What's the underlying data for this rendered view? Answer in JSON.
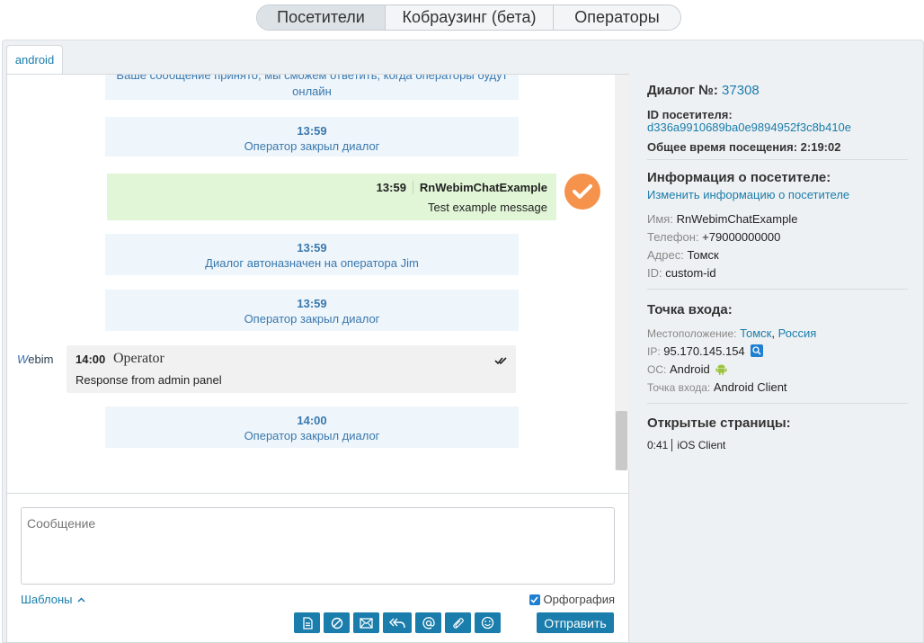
{
  "top_tabs": [
    "Посетители",
    "Кобраузинг (бета)",
    "Операторы"
  ],
  "subtab": "android",
  "messages": {
    "partial_text": "Ваше сообщение принято, мы сможем ответить, когда операторы будут онлайн",
    "sys1": {
      "time": "13:59",
      "text": "Оператор закрыл диалог"
    },
    "visitor": {
      "time": "13:59",
      "name": "RnWebimChatExample",
      "text": "Test example message"
    },
    "sys2": {
      "time": "13:59",
      "text": "Диалог автоназначен на оператора Jim"
    },
    "sys3": {
      "time": "13:59",
      "text": "Оператор закрыл диалог"
    },
    "operator": {
      "logo": "Webim",
      "time": "14:00",
      "name": "Operator",
      "text": "Response from admin panel"
    },
    "sys4": {
      "time": "14:00",
      "text": "Оператор закрыл диалог"
    }
  },
  "composer": {
    "placeholder": "Сообщение",
    "templates_label": "Шаблоны",
    "spellcheck_label": "Орфография",
    "spellcheck_checked": true,
    "toolbar_icons": [
      "document-icon",
      "block-icon",
      "mail-icon",
      "reply-all-icon",
      "at-icon",
      "attach-icon",
      "smile-icon"
    ],
    "send_label": "Отправить"
  },
  "right": {
    "dialog_label": "Диалог №:",
    "dialog_number": "37308",
    "visitor_id_label": "ID посетителя:",
    "visitor_id": "d336a9910689ba0e9894952f3c8b410e",
    "visit_time_label": "Общее время посещения:",
    "visit_time": "2:19:02",
    "info_title": "Информация о посетителе:",
    "edit_info_link": "Изменить информацию о посетителе",
    "name_k": "Имя:",
    "name_v": "RnWebimChatExample",
    "phone_k": "Телефон:",
    "phone_v": "+79000000000",
    "address_k": "Адрес:",
    "address_v": "Томск",
    "id_k": "ID:",
    "id_v": "custom-id",
    "entry_title": "Точка входа:",
    "location_k": "Местоположение:",
    "location_city": "Томск",
    "location_country": "Россия",
    "ip_k": "IP:",
    "ip_v": "95.170.145.154",
    "os_k": "ОС:",
    "os_v": "Android",
    "entry_k": "Точка входа:",
    "entry_v": "Android Client",
    "pages_title": "Открытые страницы:",
    "page_time": "0:41",
    "page_name": "iOS Client"
  },
  "colors": {
    "accent": "#1a7dab",
    "visitor_bubble": "#e1f6d7",
    "system_bubble": "#eef5fb",
    "delivered_badge": "#f5924b"
  }
}
